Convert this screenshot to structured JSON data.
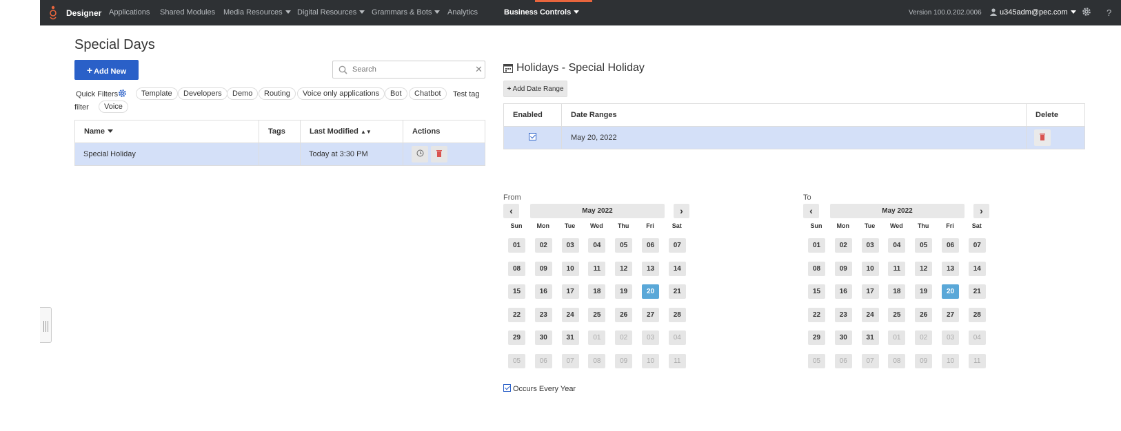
{
  "topbar": {
    "brand": "Designer",
    "nav": [
      {
        "label": "Applications",
        "dropdown": false
      },
      {
        "label": "Shared Modules",
        "dropdown": false
      },
      {
        "label": "Media Resources",
        "dropdown": true
      },
      {
        "label": "Digital Resources",
        "dropdown": true
      },
      {
        "label": "Grammars & Bots",
        "dropdown": true
      },
      {
        "label": "Analytics",
        "dropdown": false
      },
      {
        "label": "Business Controls",
        "dropdown": true,
        "active": true
      }
    ],
    "version": "Version 100.0.202.0006",
    "user": "u345adm@pec.com"
  },
  "page": {
    "title": "Special Days",
    "add_new": "Add New",
    "search_placeholder": "Search"
  },
  "quick_filters": {
    "label": "Quick Filters",
    "chips": [
      "Template",
      "Developers",
      "Demo",
      "Routing",
      "Voice only applications",
      "Bot",
      "Chatbot",
      "Test tag",
      "filter",
      "Voice"
    ]
  },
  "list": {
    "columns": [
      "Name",
      "Tags",
      "Last Modified",
      "Actions"
    ],
    "rows": [
      {
        "name": "Special Holiday",
        "tags": "",
        "modified": "Today at 3:30 PM"
      }
    ]
  },
  "detail": {
    "title": "Holidays - Special Holiday",
    "add_range": "Add Date Range",
    "columns": [
      "Enabled",
      "Date Ranges",
      "Delete"
    ],
    "rows": [
      {
        "enabled": true,
        "range": "May 20, 2022"
      }
    ]
  },
  "calendars": [
    {
      "label": "From",
      "month": "May 2022",
      "selected": "20"
    },
    {
      "label": "To",
      "month": "May 2022",
      "selected": "20"
    }
  ],
  "weekdays": [
    "Sun",
    "Mon",
    "Tue",
    "Wed",
    "Thu",
    "Fri",
    "Sat"
  ],
  "days": [
    "01",
    "02",
    "03",
    "04",
    "05",
    "06",
    "07",
    "08",
    "09",
    "10",
    "11",
    "12",
    "13",
    "14",
    "15",
    "16",
    "17",
    "18",
    "19",
    "20",
    "21",
    "22",
    "23",
    "24",
    "25",
    "26",
    "27",
    "28",
    "29",
    "30",
    "31",
    "01",
    "02",
    "03",
    "04",
    "05",
    "06",
    "07",
    "08",
    "09",
    "10",
    "11"
  ],
  "occurs_every_year": {
    "label": "Occurs Every Year",
    "checked": true
  },
  "colors": {
    "accent": "#e8653d",
    "primary": "#2a60c8",
    "row_selected": "#d4e0f8",
    "day_selected": "#5aa8d8",
    "topbar": "#2e3134"
  }
}
